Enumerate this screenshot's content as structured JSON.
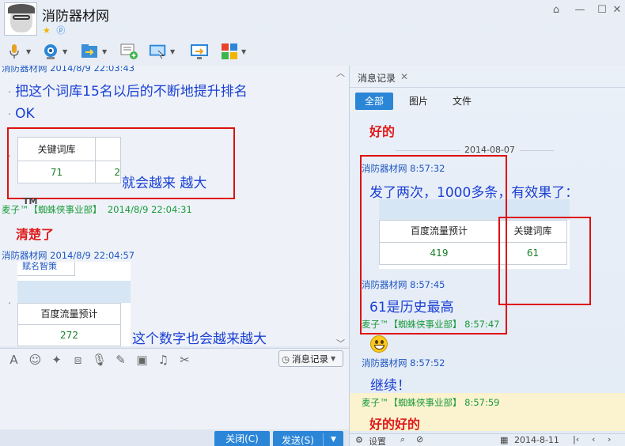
{
  "window": {
    "title": "消防器材网",
    "controls": {
      "minimize": "—",
      "maximize": "☐",
      "close": "✕",
      "skin": "⌂"
    }
  },
  "toolbar": {
    "icons": [
      "microphone-icon",
      "video-camera-icon",
      "file-transfer-icon",
      "add-chat-icon",
      "remote-assist-icon",
      "share-screen-icon",
      "apps-icon"
    ]
  },
  "chat": {
    "top_meta": "消防器材网 2014/8/9 22:03:43",
    "messages": [
      {
        "text": "把这个词库15名以后的不断地提升排名"
      },
      {
        "text": "OK"
      }
    ],
    "table1": {
      "header": "关键词库",
      "value": "71",
      "partial": "2"
    },
    "caption1": "就会越来  越大",
    "meta2": {
      "name": "麦子™【蜘蛛侠事业部】",
      "time": "2014/8/9 22:04:31"
    },
    "tm": "TM",
    "reply2": "清楚了",
    "meta3": "消防器材网 2014/8/9 22:04:57",
    "table2": {
      "cut_header": "赋名智策",
      "header": "百度流量预计",
      "value": "272"
    },
    "caption2": "这个数字也会越来越大"
  },
  "input": {
    "history_label": "消息记录",
    "close_label": "关闭(C)",
    "send_label": "发送(S)"
  },
  "history": {
    "tab_label": "消息记录",
    "filters": [
      "全部",
      "图片",
      "文件"
    ],
    "top_reply": "好的",
    "date": "2014-08-07",
    "m1_meta": "消防器材网 8:57:32",
    "m1_text": "发了两次，1000多条，有效果了：",
    "m1_table": {
      "col1": "百度流量预计",
      "col2": "关键词库",
      "v1": "419",
      "v2": "61"
    },
    "m2_meta": "消防器材网 8:57:45",
    "m2_text": "61是历史最高",
    "m3_meta": "麦子™【蜘蛛侠事业部】 8:57:47",
    "m4_meta": "消防器材网 8:57:52",
    "m4_text": "继续！",
    "m5_meta": "麦子™【蜘蛛侠事业部】 8:57:59",
    "m5_text": "好的好的",
    "bottom": {
      "settings": "设置",
      "date": "2014-8-11"
    }
  }
}
